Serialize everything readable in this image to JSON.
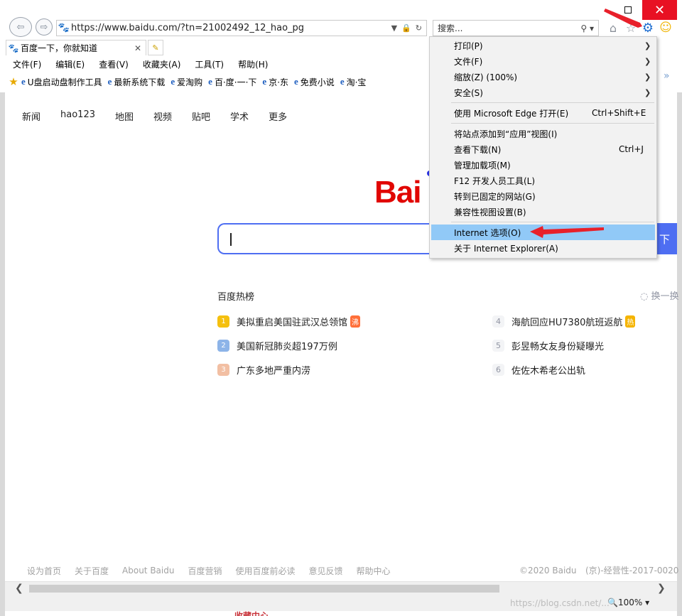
{
  "browser": {
    "address_url": "https://www.baidu.com/?tn=21002492_12_hao_pg",
    "search_placeholder": "搜索...",
    "tab_title": "百度一下，你就知道",
    "zoom_level": "100%",
    "menu_bar": [
      "文件(F)",
      "编辑(E)",
      "查看(V)",
      "收藏夹(A)",
      "工具(T)",
      "帮助(H)"
    ],
    "favorites": [
      "U盘启动盘制作工具",
      "最新系统下载",
      "爱淘购",
      "百·度·一·下",
      "京·东",
      "免费小说",
      "淘·宝"
    ]
  },
  "page": {
    "top_nav": [
      "新闻",
      "hao123",
      "地图",
      "视频",
      "贴吧",
      "学术",
      "更多"
    ],
    "logo_text": "Bai",
    "search_button_text": "下",
    "hot_title": "百度热榜",
    "refresh_label": "换一换",
    "hot_list": [
      {
        "rank": "1",
        "text": "美拟重启美国驻武汉总领馆",
        "tag": "沸"
      },
      {
        "rank": "2",
        "text": "美国新冠肺炎超197万例",
        "tag": ""
      },
      {
        "rank": "3",
        "text": "广东多地严重内涝",
        "tag": ""
      },
      {
        "rank": "4",
        "text": "海航回应HU7380航班返航",
        "tag": "热"
      },
      {
        "rank": "5",
        "text": "彭昱畅女友身份疑曝光",
        "tag": ""
      },
      {
        "rank": "6",
        "text": "佐佐木希老公出轨",
        "tag": ""
      }
    ],
    "footer_links": [
      "设为首页",
      "关于百度",
      "About Baidu",
      "百度营销",
      "使用百度前必读",
      "意见反馈",
      "帮助中心"
    ],
    "copyright": "©2020 Baidu",
    "license": "(京)-经营性-2017-0020",
    "bottom_partial": "收藏中心"
  },
  "tools_menu": {
    "items": [
      {
        "label": "打印(P)",
        "submenu": true
      },
      {
        "label": "文件(F)",
        "submenu": true
      },
      {
        "label": "缩放(Z) (100%)",
        "submenu": true
      },
      {
        "label": "安全(S)",
        "submenu": true
      },
      {
        "label": "使用 Microsoft Edge 打开(E)",
        "shortcut": "Ctrl+Shift+E"
      },
      {
        "label": "将站点添加到“应用”视图(I)"
      },
      {
        "label": "查看下载(N)",
        "shortcut": "Ctrl+J"
      },
      {
        "label": "管理加载项(M)"
      },
      {
        "label": "F12 开发人员工具(L)"
      },
      {
        "label": "转到已固定的网站(G)"
      },
      {
        "label": "兼容性视图设置(B)"
      },
      {
        "label": "Internet 选项(O)",
        "highlighted": true
      },
      {
        "label": "关于 Internet Explorer(A)"
      }
    ]
  },
  "watermark": "https://blog.csdn.net/...",
  "colors": {
    "accent_blue": "#4e6ef2",
    "close_red": "#e81123",
    "highlight": "#91c9f7",
    "annotation_red": "#e8202a",
    "baidu_red": "#e10602"
  }
}
